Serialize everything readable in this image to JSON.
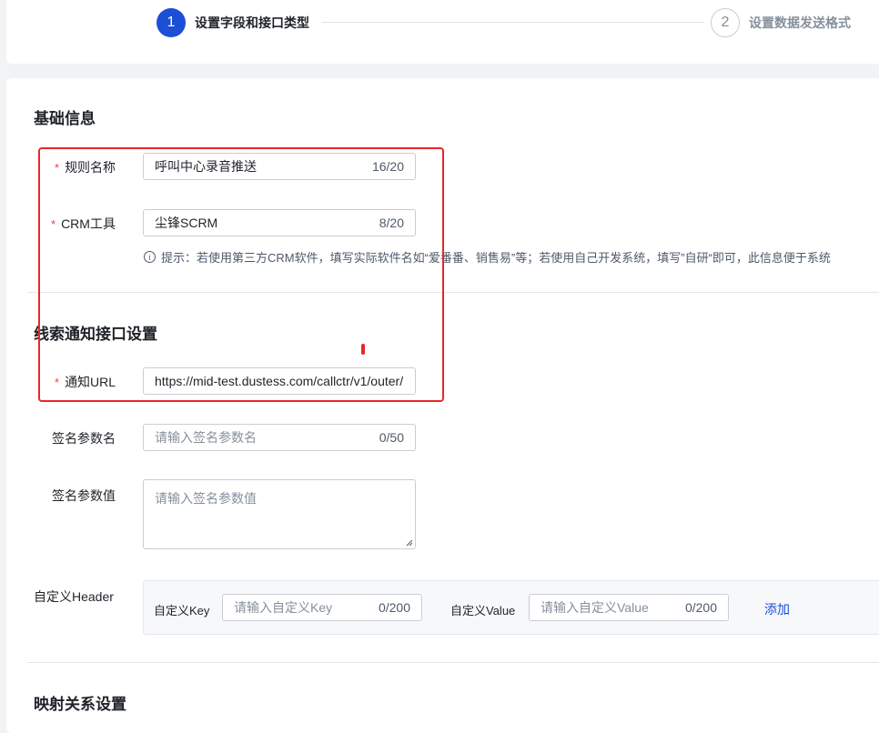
{
  "steps": [
    {
      "num": "1",
      "label": "设置字段和接口类型"
    },
    {
      "num": "2",
      "label": "设置数据发送格式"
    }
  ],
  "basic_info": {
    "title": "基础信息",
    "rule_name": {
      "label": "规则名称",
      "value": "呼叫中心录音推送",
      "count": "16/20"
    },
    "crm_tool": {
      "label": "CRM工具",
      "value": "尘锋SCRM",
      "count": "8/20"
    },
    "hint": "提示：若使用第三方CRM软件，填写实际软件名如“爱番番、销售易”等；若使用自己开发系统，填写”自研“即可，此信息便于系统"
  },
  "notify": {
    "title": "线索通知接口设置",
    "url": {
      "label": "通知URL",
      "value": "https://mid-test.dustess.com/callctr/v1/outer/"
    },
    "sign_name": {
      "label": "签名参数名",
      "placeholder": "请输入签名参数名",
      "count": "0/50"
    },
    "sign_value": {
      "label": "签名参数值",
      "placeholder": "请输入签名参数值"
    },
    "custom_header": {
      "label": "自定义Header",
      "key_label": "自定义Key",
      "key_placeholder": "请输入自定义Key",
      "key_count": "0/200",
      "value_label": "自定义Value",
      "value_placeholder": "请输入自定义Value",
      "value_count": "0/200",
      "add": "添加"
    }
  },
  "mapping": {
    "title": "映射关系设置"
  },
  "colors": {
    "accent": "#1a4fd6",
    "required": "#f53f3f",
    "highlight": "#e8262a"
  }
}
